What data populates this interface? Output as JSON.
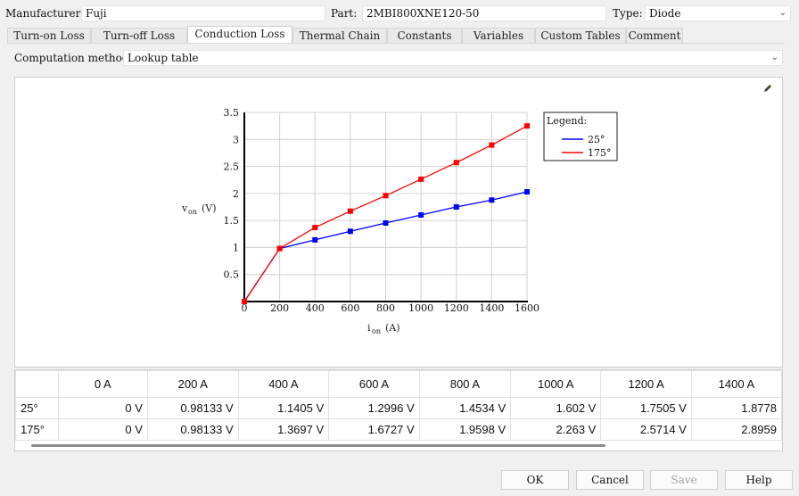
{
  "header": {
    "manufacturer_label": "Manufacturer:",
    "manufacturer_value": "Fuji",
    "part_label": "Part:",
    "part_value": "2MBI800XNE120-50",
    "type_label": "Type:",
    "type_value": "Diode"
  },
  "tabs": [
    {
      "label": "Turn-on Loss"
    },
    {
      "label": "Turn-off Loss"
    },
    {
      "label": "Conduction Loss",
      "active": true
    },
    {
      "label": "Thermal Chain"
    },
    {
      "label": "Constants"
    },
    {
      "label": "Variables"
    },
    {
      "label": "Custom Tables"
    },
    {
      "label": "Comment"
    }
  ],
  "computation": {
    "label": "Computation method:",
    "value": "Lookup table"
  },
  "chart_data": {
    "type": "line",
    "x": [
      0,
      200,
      400,
      600,
      800,
      1000,
      1200,
      1400,
      1600
    ],
    "series": [
      {
        "name": "25°",
        "color": "#0000ff",
        "values": [
          0,
          0.98133,
          1.1405,
          1.2996,
          1.4534,
          1.602,
          1.7505,
          1.8778,
          2.03
        ]
      },
      {
        "name": "175°",
        "color": "#ff0000",
        "values": [
          0,
          0.98133,
          1.3697,
          1.6727,
          1.9598,
          2.263,
          2.5714,
          2.8959,
          3.25
        ]
      }
    ],
    "xlabel_main": "i",
    "xlabel_sub": "on",
    "xlabel_unit": "(A)",
    "ylabel_main": "v",
    "ylabel_sub": "on",
    "ylabel_unit": "(V)",
    "xlim": [
      0,
      1600
    ],
    "ylim": [
      0,
      3.5
    ],
    "xticks": [
      "0",
      "200",
      "400",
      "600",
      "800",
      "1000",
      "1200",
      "1400",
      "1600"
    ],
    "yticks": [
      "0.5",
      "1",
      "1.5",
      "2",
      "2.5",
      "3",
      "3.5"
    ],
    "grid": true,
    "legend_title": "Legend:",
    "legend_position": "top-right"
  },
  "table": {
    "columns": [
      "0 A",
      "200 A",
      "400 A",
      "600 A",
      "800 A",
      "1000 A",
      "1200 A",
      "1400 A"
    ],
    "rows": [
      {
        "label": "25°",
        "values": [
          "0 V",
          "0.98133 V",
          "1.1405 V",
          "1.2996 V",
          "1.4534 V",
          "1.602 V",
          "1.7505 V",
          "1.8778"
        ]
      },
      {
        "label": "175°",
        "values": [
          "0 V",
          "0.98133 V",
          "1.3697 V",
          "1.6727 V",
          "1.9598 V",
          "2.263 V",
          "2.5714 V",
          "2.8959"
        ]
      }
    ]
  },
  "buttons": {
    "ok": "OK",
    "cancel": "Cancel",
    "save": "Save",
    "help": "Help"
  },
  "colors": {
    "series_25": "#0000ff",
    "series_175": "#ff0000",
    "panel_bg": "#f0f0f0"
  }
}
